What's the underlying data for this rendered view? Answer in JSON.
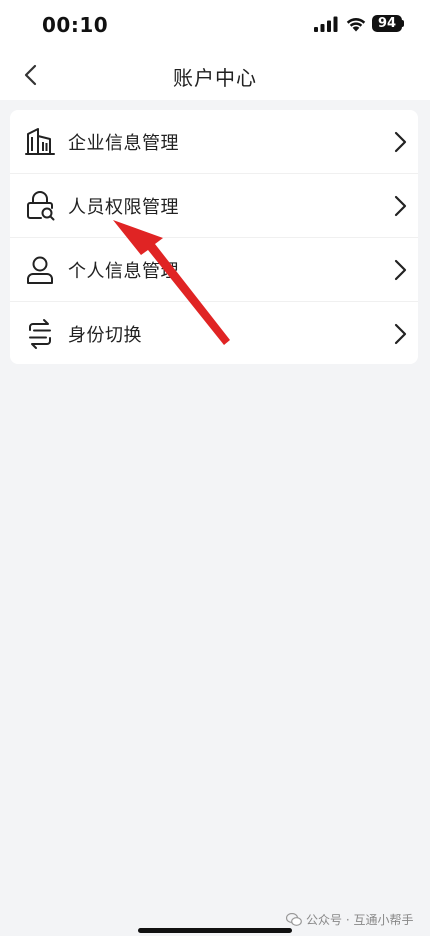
{
  "status_bar": {
    "time": "00:10",
    "battery": "94"
  },
  "nav": {
    "title": "账户中心",
    "back_icon": "chevron-left-icon"
  },
  "menu": {
    "items": [
      {
        "label": "企业信息管理",
        "icon": "building-icon"
      },
      {
        "label": "人员权限管理",
        "icon": "lock-search-icon"
      },
      {
        "label": "个人信息管理",
        "icon": "person-icon"
      },
      {
        "label": "身份切换",
        "icon": "switch-icon"
      }
    ]
  },
  "annotation": {
    "arrow_color": "#e02424",
    "points_to": "人员权限管理"
  },
  "watermark": {
    "text": "公众号 · 互通小帮手",
    "icon": "wechat-icon"
  },
  "colors": {
    "background": "#f3f4f6",
    "card": "#ffffff",
    "text": "#222222"
  }
}
